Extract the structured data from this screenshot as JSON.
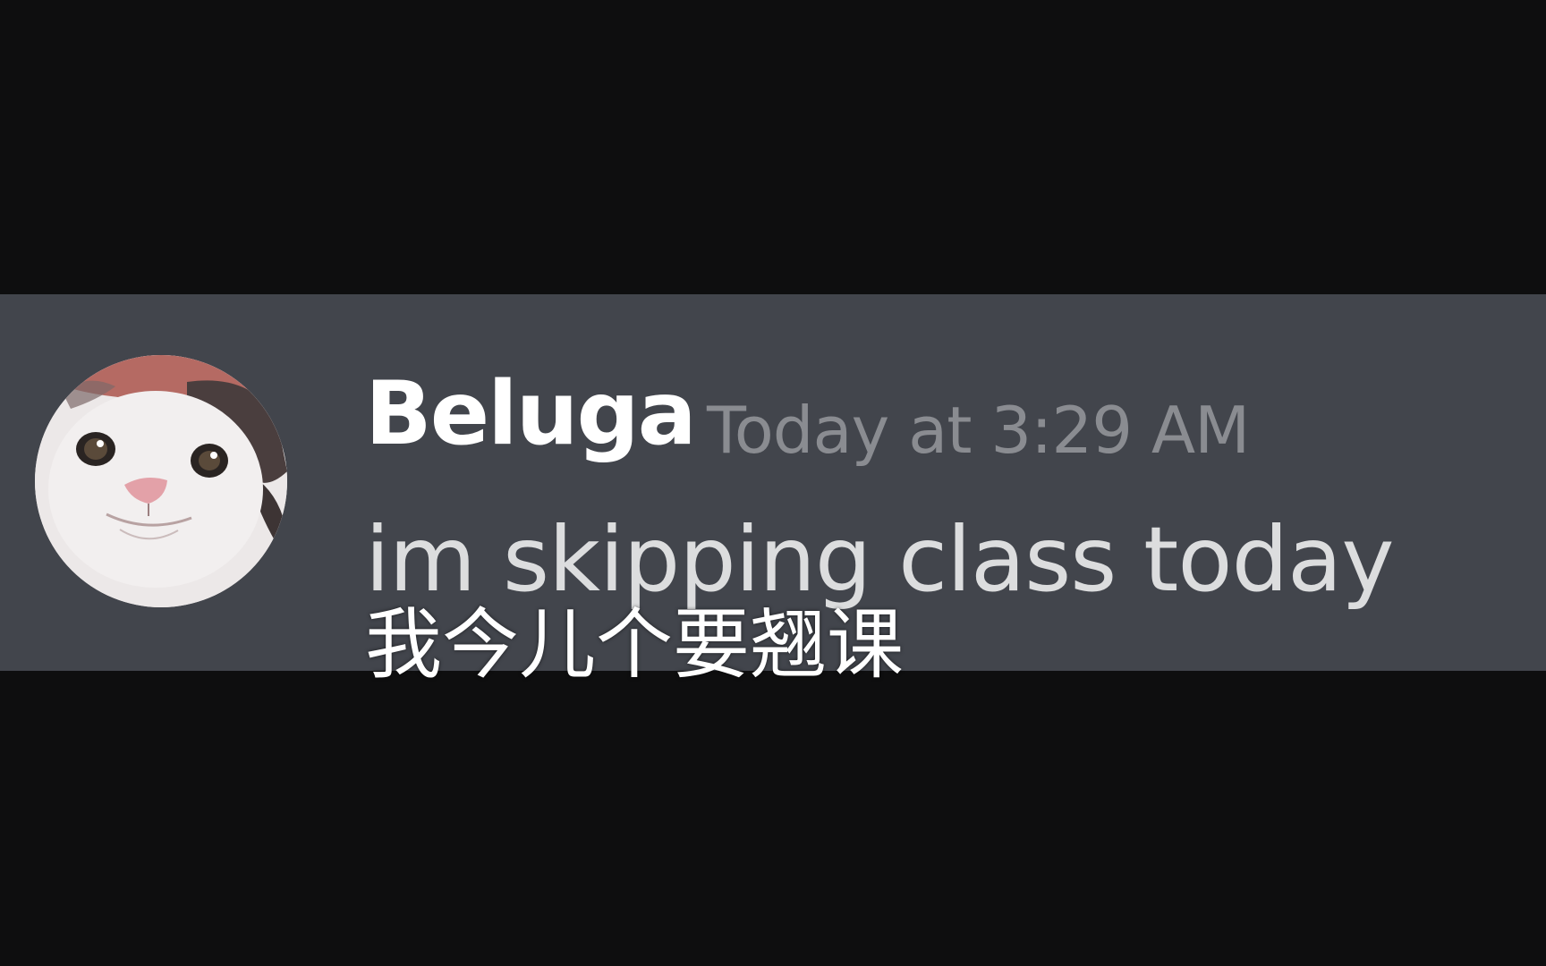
{
  "message": {
    "username": "Beluga",
    "timestamp": "Today at 3:29 AM",
    "text": "im skipping class today",
    "avatar_icon": "cat-avatar"
  },
  "subtitle": {
    "text": "我今儿个要翘课"
  },
  "colors": {
    "background": "#0e0e0f",
    "message_band": "#42454c",
    "username": "#ffffff",
    "timestamp": "#8a8c91",
    "message_text": "#dcddde"
  }
}
